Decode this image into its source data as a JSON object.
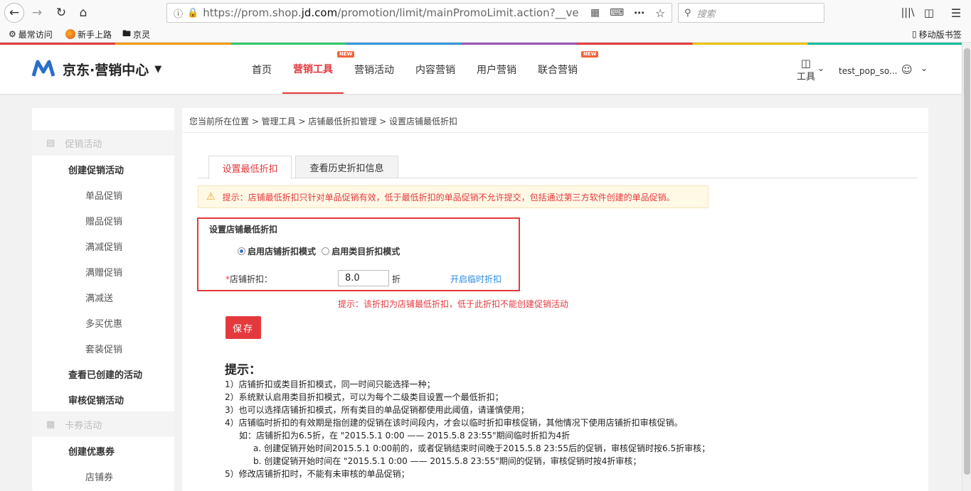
{
  "browser": {
    "url": "https://prom.shop.jd.com/promotion/limit/mainPromoLimit.action?__vender_",
    "url_prefix": "https://prom.shop.",
    "url_domain": "jd.com",
    "url_suffix": "/promotion/limit/mainPromoLimit.action?__vender_",
    "search_placeholder": "搜索",
    "bookmarks": [
      "最常访问",
      "新手上路",
      "京灵"
    ],
    "mobile_bookmarks": "移动版书签"
  },
  "header": {
    "logo_text": "京东·营销中心",
    "nav": [
      {
        "label": "首页",
        "new": false
      },
      {
        "label": "营销工具",
        "new": true,
        "active": true
      },
      {
        "label": "营销活动",
        "new": false
      },
      {
        "label": "内容营销",
        "new": false
      },
      {
        "label": "用户营销",
        "new": false
      },
      {
        "label": "联合营销",
        "new": true
      }
    ],
    "new_badge": "NEW",
    "tools_label": "工具",
    "username": "test_pop_so..."
  },
  "sidebar": {
    "groups": [
      "促销活动",
      "卡券活动"
    ],
    "items": [
      "创建促销活动",
      "单品促销",
      "赠品促销",
      "满减促销",
      "满赠促销",
      "满减送",
      "多买优惠",
      "套装促销",
      "查看已创建的活动",
      "审核促销活动",
      "创建优惠券",
      "店铺券"
    ]
  },
  "main": {
    "breadcrumb": "您当前所在位置 > 管理工具 > 店铺最低折扣管理 > 设置店铺最低折扣",
    "tabs": [
      "设置最低折扣",
      "查看历史折扣信息"
    ],
    "warning": "提示：店铺最低折扣只针对单品促销有效，低于最低折扣的单品促销不允许提交，包括通过第三方软件创建的单品促销。",
    "section_title": "设置店铺最低折扣",
    "radio_store": "启用店铺折扣模式",
    "radio_category": "启用类目折扣模式",
    "discount_label": "店铺折扣：",
    "required_mark": "*",
    "discount_value": "8.0",
    "discount_unit": "折",
    "temp_link": "开启临时折扣",
    "discount_hint": "提示：该折扣为店铺最低折扣，低于此折扣不能创建促销活动",
    "save_label": "保存",
    "tips_title": "提示：",
    "tips": [
      "1）店铺折扣或类目折扣模式，同一时间只能选择一种；",
      "2）系统默认启用类目折扣模式，可以为每个二级类目设置一个最低折扣；",
      "3）也可以选择店铺折扣模式，所有类目的单品促销都使用此阈值，请谨慎使用；",
      "4）店铺临时折扣的有效期是指创建的促销在该时间段内，才会以临时折扣审核促销，其他情况下使用店铺折扣审核促销。",
      "如：店铺折扣为6.5折，在 \"2015.5.1 0:00 —— 2015.5.8 23:55\"期间临时折扣为4折",
      "a. 创建促销开始时间2015.5.1 0:00前的，或者促销结束时间晚于2015.5.8 23:55后的促销，审核促销时按6.5折审核；",
      "b. 创建促销开始时间在 \"2015.5.1 0:00 —— 2015.5.8 23:55\"期间的促销，审核促销时按4折审核；",
      "5）修改店铺折扣时，不能有未审核的单品促销；"
    ]
  },
  "colors": {
    "accent": "#e4393c",
    "link": "#2a8be0"
  }
}
